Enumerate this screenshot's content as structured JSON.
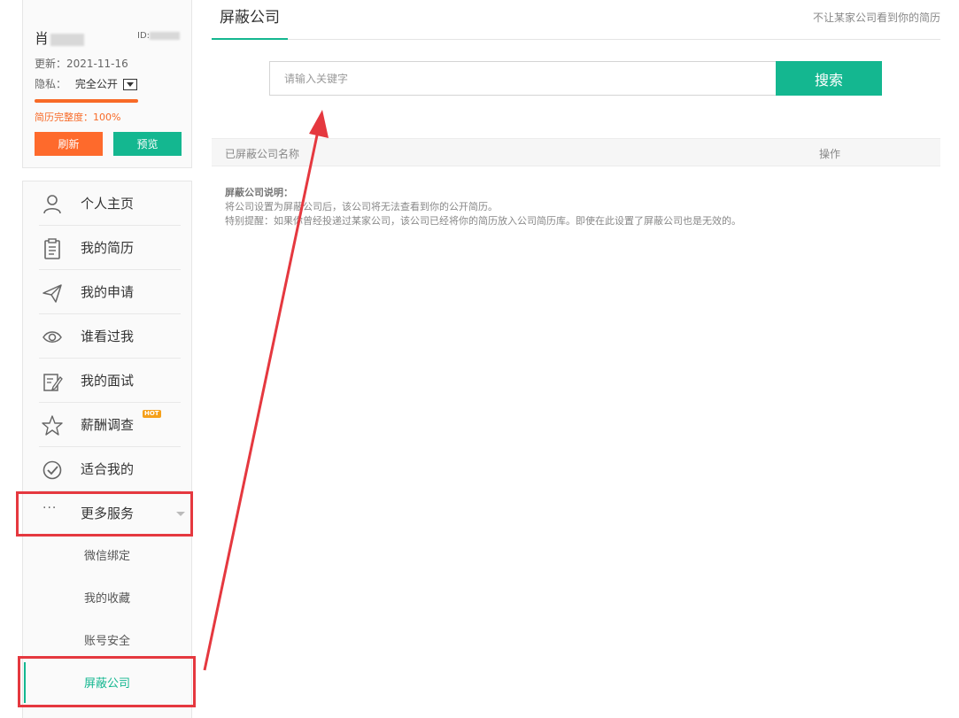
{
  "profile": {
    "name": "肖",
    "id_label": "ID:",
    "update_label": "更新：2021-11-16",
    "privacy_label": "隐私：",
    "privacy_value": "完全公开",
    "completeness_label": "简历完整度：100%",
    "completeness_percent": 100,
    "refresh_button": "刷新",
    "preview_button": "预览"
  },
  "sidebar": {
    "items": [
      {
        "label": "个人主页",
        "icon": "person-icon"
      },
      {
        "label": "我的简历",
        "icon": "clipboard-icon"
      },
      {
        "label": "我的申请",
        "icon": "paper-plane-icon"
      },
      {
        "label": "谁看过我",
        "icon": "eye-icon"
      },
      {
        "label": "我的面试",
        "icon": "edit-icon"
      },
      {
        "label": "薪酬调查",
        "icon": "star-icon",
        "badge": "HOT"
      },
      {
        "label": "适合我的",
        "icon": "check-circle-icon"
      },
      {
        "label": "更多服务",
        "icon": "more-dots-icon",
        "dots": "···"
      }
    ],
    "sub_items": [
      {
        "label": "微信绑定"
      },
      {
        "label": "我的收藏"
      },
      {
        "label": "账号安全"
      },
      {
        "label": "屏蔽公司",
        "active": true
      }
    ]
  },
  "main": {
    "tab_title": "屏蔽公司",
    "tab_hint": "不让某家公司看到你的简历",
    "search": {
      "placeholder": "请输入关键字",
      "value": "",
      "button_label": "搜索"
    },
    "table": {
      "columns": [
        "已屏蔽公司名称",
        "操作"
      ],
      "rows": []
    },
    "notes": {
      "title": "屏蔽公司说明：",
      "lines": [
        "将公司设置为屏蔽公司后，该公司将无法查看到你的公开简历。",
        "特别提醒：如果你曾经投递过某家公司，该公司已经将你的简历放入公司简历库。即使在此设置了屏蔽公司也是无效的。"
      ]
    }
  },
  "colors": {
    "accent": "#14b790",
    "orange": "#fe6a2c",
    "annotation_red": "#e5383f"
  }
}
